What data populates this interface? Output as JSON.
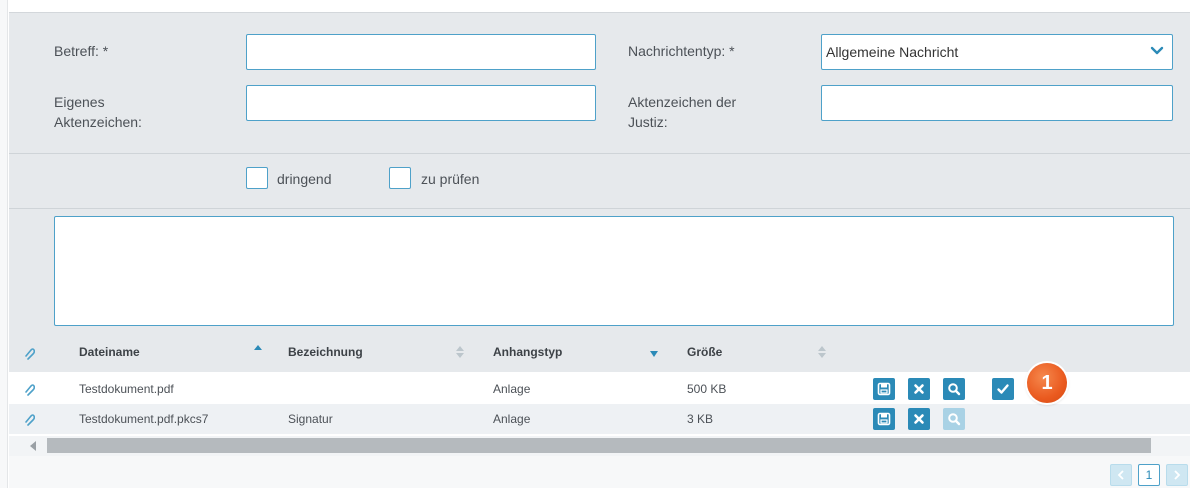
{
  "form": {
    "subject_label": "Betreff: *",
    "subject_value": "",
    "own_ref_label_line1": "Eigenes",
    "own_ref_label_line2": "Aktenzeichen:",
    "own_ref_value": "",
    "message_type_label": "Nachrichtentyp: *",
    "message_type_value": "Allgemeine Nachricht",
    "court_ref_label_line1": "Aktenzeichen der",
    "court_ref_label_line2": "Justiz:",
    "court_ref_value": "",
    "urgent_label": "dringend",
    "check_label": "zu prüfen",
    "message_body": ""
  },
  "table": {
    "columns": {
      "filename": "Dateiname",
      "description": "Bezeichnung",
      "attachment_type": "Anhangstyp",
      "size": "Größe"
    },
    "rows": [
      {
        "filename": "Testdokument.pdf",
        "description": "",
        "attachment_type": "Anlage",
        "size": "500 KB"
      },
      {
        "filename": "Testdokument.pdf.pkcs7",
        "description": "Signatur",
        "attachment_type": "Anlage",
        "size": "3 KB"
      }
    ]
  },
  "callout": {
    "number": "1"
  },
  "pager": {
    "current_page": "1"
  },
  "colors": {
    "accent": "#2b8ab7",
    "border": "#4ea1c9",
    "panel": "#e6e9ec",
    "badge": "#ea5a1f"
  },
  "icons": [
    "paperclip-icon",
    "save-icon",
    "delete-icon",
    "search-icon",
    "check-icon",
    "chevron-down-icon",
    "sort-asc-icon",
    "sort-desc-icon",
    "sort-neutral-icon"
  ]
}
